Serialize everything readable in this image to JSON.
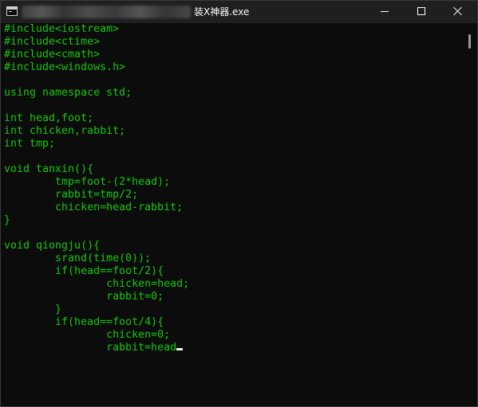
{
  "window": {
    "title": "装X神器.exe",
    "buttons": {
      "minimize": "minimize",
      "maximize": "maximize",
      "close": "close"
    }
  },
  "console": {
    "text_color": "#16c60c",
    "background": "#0c0c0c",
    "lines": [
      "#include<iostream>",
      "#include<ctime>",
      "#include<cmath>",
      "#include<windows.h>",
      "",
      "using namespace std;",
      "",
      "int head,foot;",
      "int chicken,rabbit;",
      "int tmp;",
      "",
      "void tanxin(){",
      "        tmp=foot-(2*head);",
      "        rabbit=tmp/2;",
      "        chicken=head-rabbit;",
      "}",
      "",
      "void qiongju(){",
      "        srand(time(0));",
      "        if(head==foot/2){",
      "                chicken=head;",
      "                rabbit=0;",
      "        }",
      "        if(head==foot/4){",
      "                chicken=0;",
      "                rabbit=head"
    ]
  },
  "icons": {
    "app": "console-app-icon",
    "minimize": "minimize-icon",
    "maximize": "maximize-icon",
    "close": "close-icon"
  }
}
